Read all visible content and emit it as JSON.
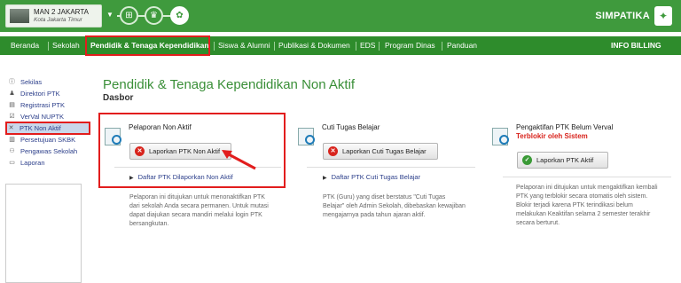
{
  "header": {
    "school_name": "MAN 2 JAKARTA",
    "school_city": "Kota Jakarta Timur",
    "brand": "SIMPATIKA",
    "icons": [
      "sitemap-icon",
      "users-icon",
      "gear-icon"
    ]
  },
  "nav": {
    "items": [
      "Beranda",
      "Sekolah",
      "Pendidik & Tenaga Kependidikan",
      "Siswa & Alumni",
      "Publikasi & Dokumen",
      "EDS",
      "Program Dinas",
      "Panduan"
    ],
    "right": "INFO BILLING",
    "active": "Pendidik & Tenaga Kependidikan"
  },
  "sidebar": {
    "items": [
      {
        "label": "Sekilas",
        "icon": "info-icon"
      },
      {
        "label": "Direktori PTK",
        "icon": "person-icon"
      },
      {
        "label": "Registrasi PTK",
        "icon": "document-icon"
      },
      {
        "label": "VerVal NUPTK",
        "icon": "checkbox-icon"
      },
      {
        "label": "PTK Non Aktif",
        "icon": "x-icon"
      },
      {
        "label": "Persetujuan SKBK",
        "icon": "document-icon"
      },
      {
        "label": "Pengawas Sekolah",
        "icon": "people-icon"
      },
      {
        "label": "Laporan",
        "icon": "folder-icon"
      }
    ],
    "active": "PTK Non Aktif"
  },
  "main": {
    "title": "Pendidik & Tenaga Kependidikan Non Aktif",
    "subtitle": "Dasbor",
    "cards": [
      {
        "title": "Pelaporan Non Aktif",
        "button": "Laporkan PTK Non Aktif",
        "link": "Daftar PTK Dilaporkan Non Aktif",
        "desc": [
          "Pelaporan ini ditujukan untuk menonaktifkan PTK",
          "dari sekolah Anda secara permanen. Untuk mutasi",
          "dapat diajukan secara mandiri melalui login PTK",
          "bersangkutan."
        ]
      },
      {
        "title": "Cuti Tugas Belajar",
        "button": "Laporkan Cuti Tugas Belajar",
        "link": "Daftar PTK Cuti Tugas Belajar",
        "desc": [
          "PTK (Guru) yang diset berstatus \"Cuti Tugas",
          "Belajar\" oleh Admin Sekolah, dibebaskan kewajiban",
          "mengajarnya pada tahun ajaran aktif."
        ]
      },
      {
        "title": "Pengaktifan PTK Belum Verval",
        "warning": "Terblokir oleh Sistem",
        "button": "Laporkan PTK Aktif",
        "desc": [
          "Pelaporan ini ditujukan untuk mengaktifkan kembali",
          "PTK yang terblokir secara otomatis oleh sistem.",
          "Blokir terjadi karena PTK terindikasi belum",
          "melakukan Keaktifan selama 2 semester terakhir",
          "secara berturut."
        ]
      }
    ]
  },
  "colors": {
    "brand_green": "#3f9a3d",
    "nav_green": "#2e8c2c",
    "highlight_red": "#e21d1d",
    "warning_red": "#d8241d"
  }
}
